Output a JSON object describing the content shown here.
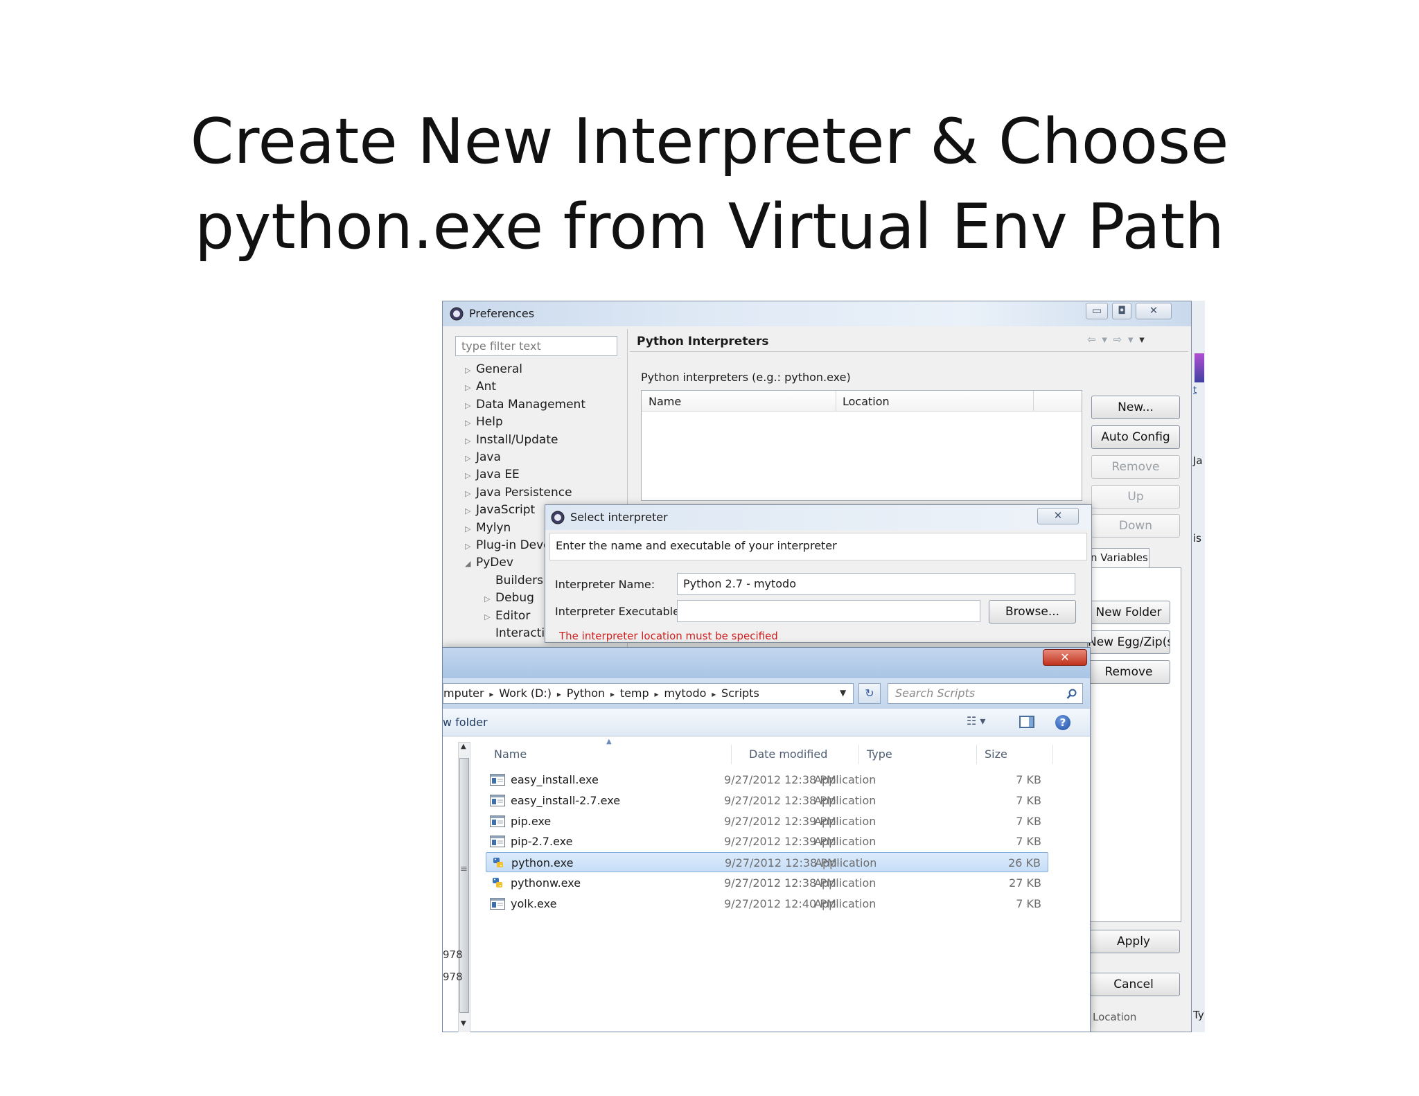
{
  "slide": {
    "title_line1": "Create New Interpreter & Choose",
    "title_line2": "python.exe from Virtual Env Path"
  },
  "preferences": {
    "window_title": "Preferences",
    "filter_placeholder": "type filter text",
    "tree": [
      {
        "label": "General",
        "expander": "▷"
      },
      {
        "label": "Ant",
        "expander": "▷"
      },
      {
        "label": "Data Management",
        "expander": "▷"
      },
      {
        "label": "Help",
        "expander": "▷"
      },
      {
        "label": "Install/Update",
        "expander": "▷"
      },
      {
        "label": "Java",
        "expander": "▷"
      },
      {
        "label": "Java EE",
        "expander": "▷"
      },
      {
        "label": "Java Persistence",
        "expander": "▷"
      },
      {
        "label": "JavaScript",
        "expander": "▷"
      },
      {
        "label": "Mylyn",
        "expander": "▷"
      },
      {
        "label": "Plug-in Deve",
        "expander": "▷"
      },
      {
        "label": "PyDev",
        "expander": "◢"
      },
      {
        "label": "Builders",
        "expander": ""
      },
      {
        "label": "Debug",
        "expander": "▷"
      },
      {
        "label": "Editor",
        "expander": "▷"
      },
      {
        "label": "Interactiv",
        "expander": ""
      }
    ],
    "page_title": "Python Interpreters",
    "list_label": "Python interpreters (e.g.: python.exe)",
    "columns": {
      "name": "Name",
      "location": "Location"
    },
    "buttons": {
      "new": "New...",
      "auto_config": "Auto Config",
      "remove": "Remove",
      "up": "Up",
      "down": "Down",
      "new_folder": "New Folder",
      "new_egg": "New Egg/Zip(s)",
      "remove2": "Remove",
      "apply": "Apply",
      "cancel": "Cancel"
    },
    "tab_variables": "n Variables",
    "right_edge": {
      "ja": "Ja",
      "is": "is",
      "t": "t"
    },
    "bottom_left": {
      "a": "978",
      "b": "978"
    },
    "bottom_labels": {
      "location": "Location",
      "type": "Typ"
    }
  },
  "select_dialog": {
    "title": "Select interpreter",
    "instruction": "Enter the name and executable of your interpreter",
    "name_label": "Interpreter Name:",
    "name_value": "Python 2.7 - mytodo",
    "exe_label": "Interpreter Executable:",
    "exe_value": "",
    "browse": "Browse...",
    "error": "The interpreter location must be specified"
  },
  "file_dialog": {
    "breadcrumb": [
      "mputer",
      "Work (D:)",
      "Python",
      "temp",
      "mytodo",
      "Scripts"
    ],
    "search_placeholder": "Search Scripts",
    "new_folder": "w folder",
    "columns": {
      "name": "Name",
      "date": "Date modified",
      "type": "Type",
      "size": "Size"
    },
    "files": [
      {
        "name": "easy_install.exe",
        "date": "9/27/2012 12:38 PM",
        "type": "Application",
        "size": "7 KB",
        "icon": "app-icon"
      },
      {
        "name": "easy_install-2.7.exe",
        "date": "9/27/2012 12:38 PM",
        "type": "Application",
        "size": "7 KB",
        "icon": "app-icon"
      },
      {
        "name": "pip.exe",
        "date": "9/27/2012 12:39 PM",
        "type": "Application",
        "size": "7 KB",
        "icon": "app-icon"
      },
      {
        "name": "pip-2.7.exe",
        "date": "9/27/2012 12:39 PM",
        "type": "Application",
        "size": "7 KB",
        "icon": "app-icon"
      },
      {
        "name": "python.exe",
        "date": "9/27/2012 12:38 PM",
        "type": "Application",
        "size": "26 KB",
        "icon": "python-icon",
        "selected": true
      },
      {
        "name": "pythonw.exe",
        "date": "9/27/2012 12:38 PM",
        "type": "Application",
        "size": "27 KB",
        "icon": "python-icon"
      },
      {
        "name": "yolk.exe",
        "date": "9/27/2012 12:40 PM",
        "type": "Application",
        "size": "7 KB",
        "icon": "app-icon"
      }
    ]
  }
}
